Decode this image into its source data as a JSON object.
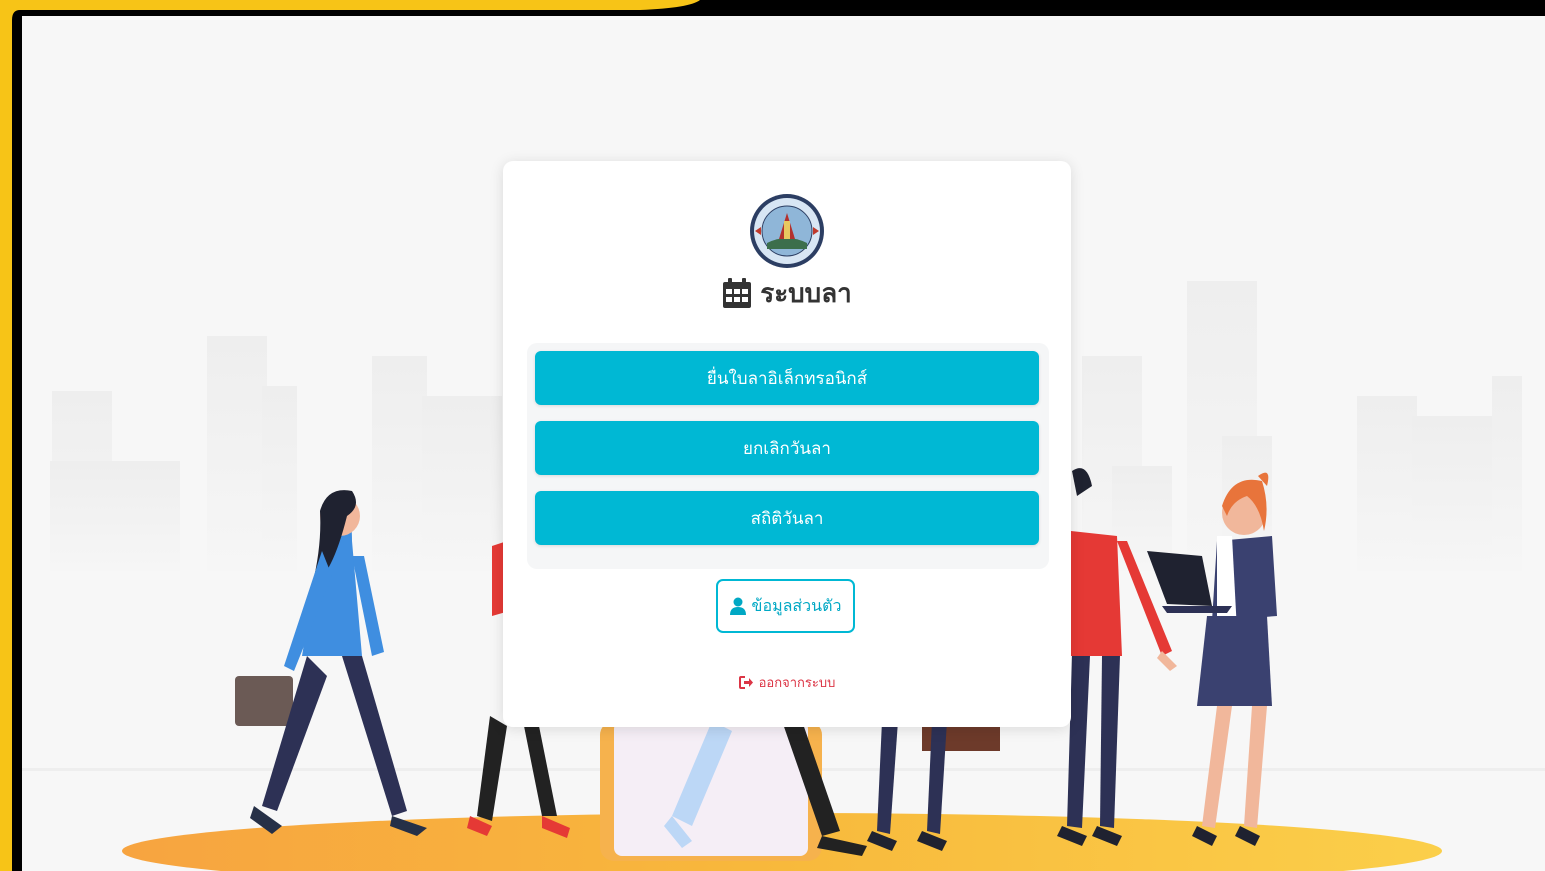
{
  "app": {
    "title": "ระบบลา"
  },
  "icons": {
    "title_icon": "calendar-icon",
    "profile_icon": "user-icon",
    "logout_icon": "sign-out-icon",
    "logo": "organization-seal"
  },
  "menu": {
    "items": [
      {
        "label": "ยื่นใบลาอิเล็กทรอนิกส์"
      },
      {
        "label": "ยกเลิกวันลา"
      },
      {
        "label": "สถิติวันลา"
      }
    ]
  },
  "profile_button": {
    "label": "ข้อมูลส่วนตัว"
  },
  "logout": {
    "label": "ออกจากระบบ"
  },
  "colors": {
    "primary": "#00b8d4",
    "danger": "#dc3545",
    "frame_accent": "#f7c417",
    "ground": "#f9a825"
  }
}
